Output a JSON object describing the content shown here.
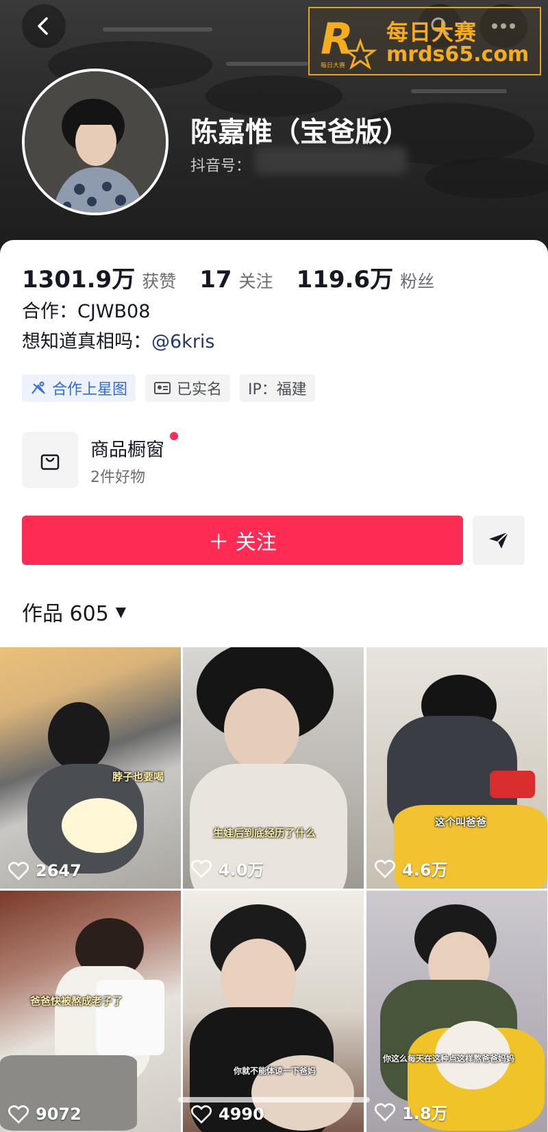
{
  "header": {
    "watermark_line1": "每日大赛",
    "watermark_line2": "mrds65.com",
    "watermark_logo_text": "每日大赛",
    "nickname": "陈嘉惟（宝爸版）",
    "douyin_id_label": "抖音号："
  },
  "stats": [
    {
      "value": "1301.9万",
      "label": "获赞"
    },
    {
      "value": "17",
      "label": "关注"
    },
    {
      "value": "119.6万",
      "label": "粉丝"
    }
  ],
  "bio": {
    "line1": "合作：CJWB08",
    "line2_prefix": "想知道真相吗：",
    "line2_mention": "@6kris"
  },
  "tags": [
    {
      "icon": "star-map-icon",
      "label": "合作上星图"
    },
    {
      "icon": "id-card-icon",
      "label": "已实名"
    },
    {
      "label": "IP：福建"
    }
  ],
  "shop": {
    "title": "商品橱窗",
    "subtitle": "2件好物",
    "icon": "shopping-bag-icon",
    "has_notification_dot": true
  },
  "actions": {
    "follow_label": "＋ 关注",
    "share_icon": "send-icon"
  },
  "works": {
    "tab_label": "作品 605",
    "arrow": "▼"
  },
  "videos": [
    {
      "likes": "2647",
      "caption": "脖子也要喝"
    },
    {
      "likes": "4.0万",
      "caption": "生娃后到底经历了什么"
    },
    {
      "likes": "4.6万",
      "caption": "这个叫爸爸"
    },
    {
      "likes": "9072",
      "caption": "爸爸快被熬成老子了"
    },
    {
      "likes": "4990",
      "caption": "你就不能体谅一下爸妈"
    },
    {
      "likes": "1.8万",
      "caption": "你这么每天在这种点这样熬爸爸妈妈"
    }
  ],
  "colors": {
    "accent": "#fe2c55",
    "mention": "#1f3a6e",
    "tag_blue": "#2f6bd3",
    "watermark": "#f4ad1f"
  }
}
